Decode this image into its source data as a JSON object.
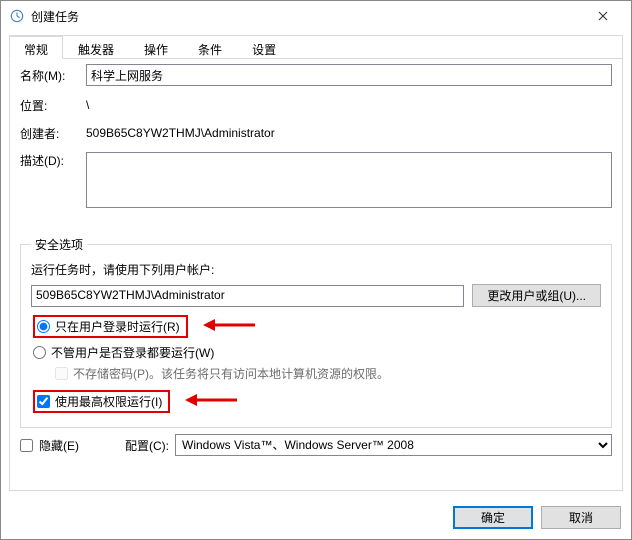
{
  "window": {
    "title": "创建任务"
  },
  "tabs": {
    "general": "常规",
    "triggers": "触发器",
    "actions": "操作",
    "conditions": "条件",
    "settings": "设置"
  },
  "general": {
    "name_label": "名称(M):",
    "name_value": "科学上网服务",
    "location_label": "位置:",
    "location_value": "\\",
    "author_label": "创建者:",
    "author_value": "509B65C8YW2THMJ\\Administrator",
    "description_label": "描述(D):",
    "description_value": ""
  },
  "security": {
    "legend": "安全选项",
    "prompt": "运行任务时，请使用下列用户帐户:",
    "user": "509B65C8YW2THMJ\\Administrator",
    "change_user_btn": "更改用户或组(U)...",
    "run_logged_on": "只在用户登录时运行(R)",
    "run_any": "不管用户是否登录都要运行(W)",
    "no_store_pw": "不存储密码(P)。该任务将只有访问本地计算机资源的权限。",
    "highest_priv": "使用最高权限运行(I)"
  },
  "bottom": {
    "hidden_label": "隐藏(E)",
    "configure_label": "配置(C):",
    "configure_value": "Windows Vista™、Windows Server™ 2008"
  },
  "dialog": {
    "ok": "确定",
    "cancel": "取消"
  }
}
